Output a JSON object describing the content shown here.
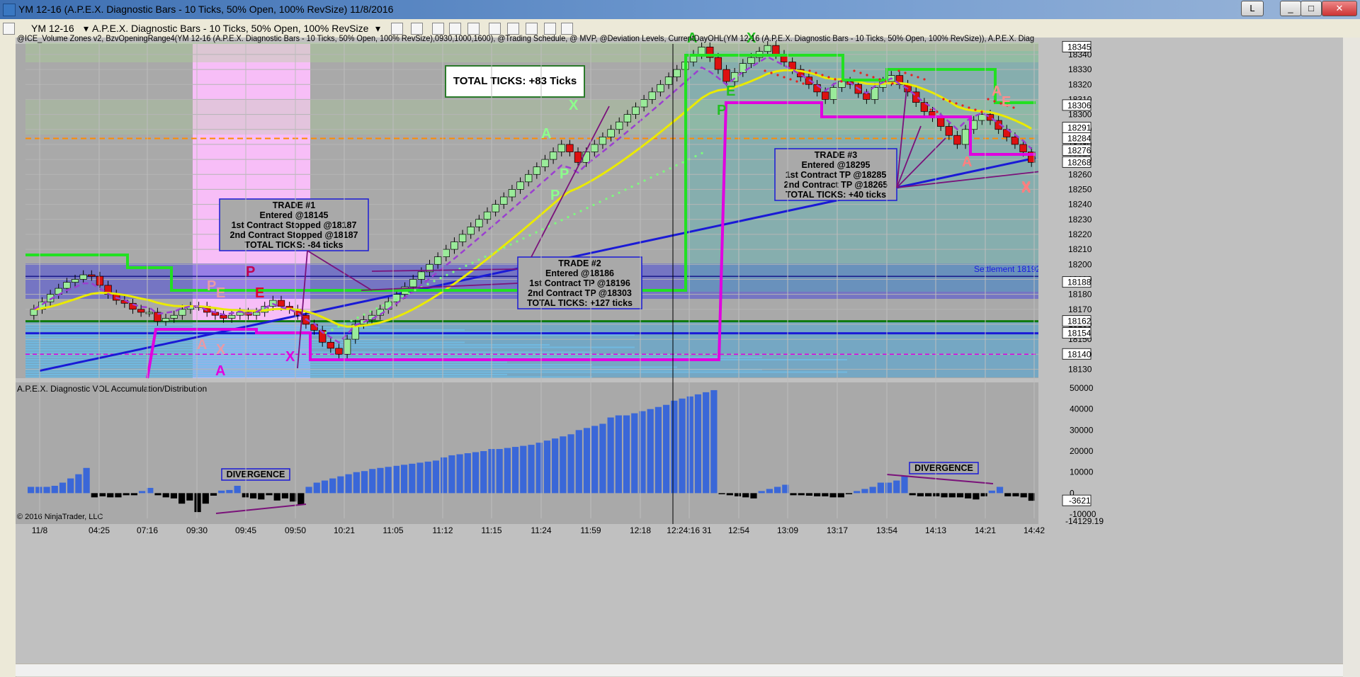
{
  "window": {
    "title": "YM 12-16 (A.P.E.X. Diagnostic Bars - 10 Ticks, 50% Open, 100% RevSize)  11/8/2016",
    "buttons": [
      "L",
      "_",
      "□",
      "✕"
    ]
  },
  "toolbar": {
    "instrument": "YM 12-16",
    "bartype": "A.P.E.X. Diagnostic Bars - 10 Ticks, 50% Open, 100% RevSize"
  },
  "price_panel": {
    "indicator_header": "@ICE_Volume Zones v2, BzvOpeningRange4(YM 12-16 (A.P.E.X. Diagnostic Bars - 10 Ticks, 50% Open, 100% RevSize),0930,1000,1600), @Trading Schedule, @ MVP, @Deviation Levels, CurrentDayOHL(YM 12-16 (A.P.E.X. Diagnostic Bars - 10 Ticks, 50% Open, 100% RevSize)), A.P.E.X. Diag",
    "y_ticks": [
      18130,
      18140,
      18150,
      18160,
      18170,
      18180,
      18190,
      18200,
      18210,
      18220,
      18230,
      18240,
      18250,
      18260,
      18270,
      18280,
      18290,
      18300,
      18310,
      18320,
      18330,
      18340
    ],
    "price_markers": [
      {
        "value": 18345,
        "label": "18345",
        "color": "#ffffff",
        "text_color": "#000000"
      },
      {
        "value": 18306,
        "label": "18306",
        "color": "#ffffff",
        "text_color": "#000000"
      },
      {
        "value": 18291,
        "label": "18291",
        "color": "#ffffff",
        "text_color": "#000000"
      },
      {
        "value": 18284,
        "label": "18284",
        "color": "#ffffff",
        "text_color": "#000000"
      },
      {
        "value": 18276,
        "label": "18276",
        "color": "#ffffff",
        "text_color": "#000000"
      },
      {
        "value": 18268,
        "label": "18268",
        "color": "#ffffff",
        "text_color": "#000000"
      },
      {
        "value": 18188,
        "label": "18188",
        "color": "#ffffff",
        "text_color": "#000000"
      },
      {
        "value": 18162,
        "label": "18162",
        "color": "#ffffff",
        "text_color": "#000000"
      },
      {
        "value": 18154,
        "label": "18154",
        "color": "#ffffff",
        "text_color": "#000000"
      },
      {
        "value": 18140,
        "label": "18140",
        "color": "#ffffff",
        "text_color": "#000000"
      }
    ],
    "settlement_label": "Settlement 18192",
    "total_box": "TOTAL TICKS: +83 Ticks",
    "trades": [
      {
        "lines": [
          "TRADE #1",
          "Entered @18145",
          "1st Contract Stopped @18187",
          "2nd Contract Stopped @18187",
          "TOTAL TICKS: -84 ticks"
        ]
      },
      {
        "lines": [
          "TRADE #2",
          "Entered @18186",
          "1st Contract TP @18196",
          "2nd Contract TP @18303",
          "TOTAL TICKS: +127 ticks"
        ]
      },
      {
        "lines": [
          "TRADE #3",
          "Entered @18295",
          "1st Contract TP @18285",
          "2nd Contract TP @18265",
          "TOTAL TICKS: +40 ticks"
        ]
      }
    ],
    "letter_markers": [
      "A",
      "X",
      "A",
      "X",
      "P",
      "E",
      "P",
      "E",
      "A",
      "X",
      "A",
      "X",
      "E",
      "P",
      "X",
      "A",
      "E",
      "P",
      "P",
      "A",
      "X"
    ]
  },
  "volume_panel": {
    "title": "A.P.E.X. Diagnostic VOL Accumulation/Distribution",
    "y_ticks": [
      "50000",
      "40000",
      "30000",
      "20000",
      "10000",
      "0",
      "-10000"
    ],
    "current_value_label": "-3621",
    "bottom_value_label": "-14129.19",
    "divergence_label": "DIVERGENCE",
    "copyright": "© 2016 NinjaTrader, LLC",
    "bars": [
      3000,
      3000,
      3000,
      3500,
      5000,
      7000,
      9000,
      12000,
      -2000,
      -1500,
      -2000,
      -2000,
      -1000,
      -1000,
      1000,
      2500,
      -1000,
      -2000,
      -2500,
      -5000,
      -3500,
      -9000,
      -5000,
      -1200,
      1200,
      1500,
      3500,
      -2000,
      -2500,
      -3000,
      -1000,
      -3500,
      -2500,
      -4000,
      -5500,
      3000,
      5000,
      6000,
      7000,
      8000,
      9000,
      10000,
      10500,
      11500,
      12000,
      12500,
      13000,
      13500,
      14000,
      14500,
      15000,
      15500,
      17000,
      18000,
      18500,
      19000,
      19500,
      20000,
      21000,
      21000,
      21500,
      22000,
      22500,
      23000,
      24000,
      25000,
      26000,
      27000,
      28000,
      30000,
      31000,
      32000,
      33000,
      36000,
      37000,
      37000,
      38000,
      39000,
      40000,
      41000,
      42000,
      44000,
      45000,
      46000,
      47000,
      48000,
      49000,
      -500,
      -1000,
      -1500,
      -2000,
      -2500,
      1000,
      2000,
      3000,
      4000,
      -1000,
      -1000,
      -1200,
      -1500,
      -1500,
      -2000,
      -2000,
      -500,
      1000,
      2000,
      3000,
      5000,
      5000,
      6000,
      8000,
      -1000,
      -1500,
      -1500,
      -1500,
      -2000,
      -2000,
      -2000,
      -2500,
      -3000,
      -1500,
      1200,
      3000,
      -1500,
      -1500,
      -2000,
      -3621
    ]
  },
  "x_axis": {
    "ticks": [
      "11/8",
      "04:25",
      "07:16",
      "09:30",
      "09:45",
      "09:50",
      "10:21",
      "11:05",
      "11:12",
      "11:15",
      "11:24",
      "11:59",
      "12:18",
      "12:24:16 31",
      "12:54",
      "13:09",
      "13:17",
      "13:54",
      "14:13",
      "14:21",
      "14:42"
    ]
  },
  "colors": {
    "up_candle": "#9aeb9a",
    "down_candle": "#dd1111",
    "volume_pos": "#3a67d8",
    "volume_neg": "#000000",
    "trend_green": "#22e022",
    "magenta": "#e000e0",
    "regression_blue": "#1a1ad6",
    "ema_yellow": "#eaea00",
    "dashed_purple": "#9b3fd0",
    "orange_dashed": "#ff8c00",
    "opening_range_pink": "#ffc0ff"
  },
  "chart_data": [
    {
      "type": "candlestick",
      "title": "",
      "ylim": [
        18125,
        18348
      ],
      "x_tick_labels": [
        "11/8",
        "04:25",
        "07:16",
        "09:30",
        "09:45",
        "09:50",
        "10:21",
        "11:05",
        "11:12",
        "11:15",
        "11:24",
        "11:59",
        "12:18",
        "12:24:16 31",
        "12:54",
        "13:09",
        "13:17",
        "13:54",
        "14:13",
        "14:21",
        "14:42"
      ],
      "close": [
        18170,
        18175,
        18180,
        18184,
        18188,
        18190,
        18193,
        18192,
        18186,
        18180,
        18176,
        18174,
        18170,
        18168,
        18168,
        18162,
        18164,
        18166,
        18170,
        18172,
        18172,
        18168,
        18166,
        18164,
        18166,
        18168,
        18166,
        18168,
        18172,
        18176,
        18172,
        18170,
        18166,
        18160,
        18156,
        18148,
        18144,
        18140,
        18150,
        18160,
        18163,
        18166,
        18170,
        18175,
        18180,
        18185,
        18190,
        18195,
        18200,
        18205,
        18210,
        18215,
        18220,
        18225,
        18230,
        18235,
        18240,
        18245,
        18250,
        18255,
        18260,
        18265,
        18270,
        18275,
        18280,
        18275,
        18268,
        18275,
        18280,
        18285,
        18290,
        18295,
        18300,
        18305,
        18310,
        18315,
        18320,
        18325,
        18330,
        18335,
        18340,
        18345,
        18338,
        18330,
        18322,
        18328,
        18334,
        18338,
        18342,
        18346,
        18340,
        18335,
        18330,
        18325,
        18320,
        18315,
        18310,
        18318,
        18322,
        18320,
        18314,
        18310,
        18318,
        18322,
        18326,
        18320,
        18315,
        18308,
        18302,
        18298,
        18292,
        18286,
        18280,
        18290,
        18296,
        18300,
        18296,
        18290,
        18285,
        18280,
        18275,
        18268
      ],
      "ylabel": "",
      "grid": true
    },
    {
      "type": "bar",
      "title": "A.P.E.X. Diagnostic VOL Accumulation/Distribution",
      "ylim": [
        -12000,
        51000
      ],
      "y_tick_labels": [
        "50000",
        "40000",
        "30000",
        "20000",
        "10000",
        "0",
        "-10000"
      ]
    }
  ]
}
